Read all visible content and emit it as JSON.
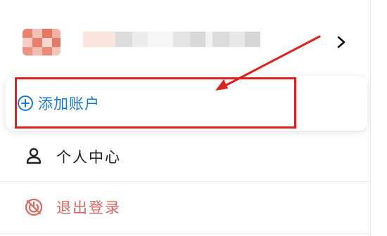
{
  "account": {
    "name_obscured": true
  },
  "add_account": {
    "label": "添加账户",
    "accent": "#1677d9"
  },
  "menu": {
    "profile_label": "个人中心",
    "logout_label": "退出登录",
    "logout_color": "#e0665e"
  },
  "annotation": {
    "color": "#e0201a"
  }
}
